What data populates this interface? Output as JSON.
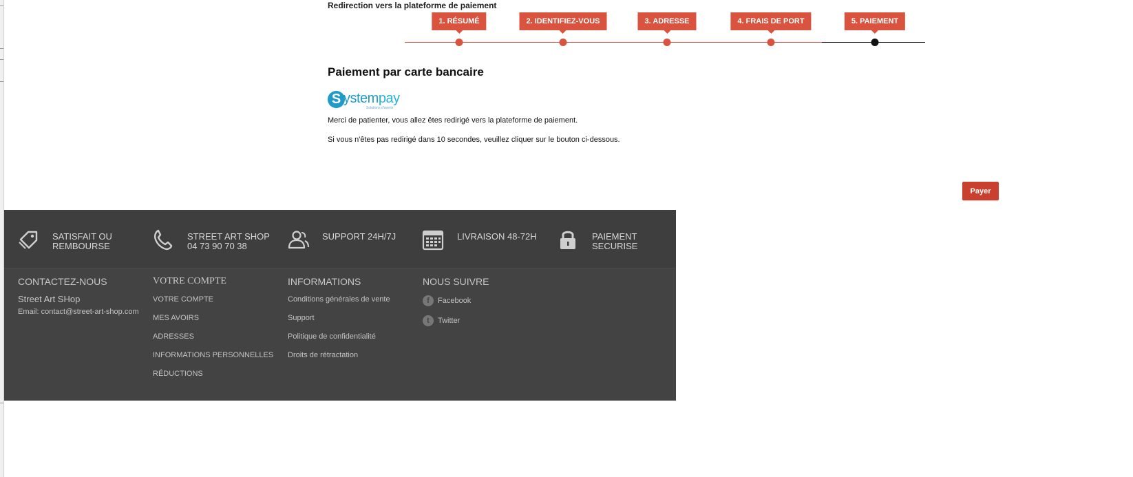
{
  "page_heading": "Redirection vers la plateforme de paiement",
  "steps": [
    {
      "label": "1. RÉSUMÉ",
      "state": "done"
    },
    {
      "label": "2. IDENTIFIEZ-VOUS",
      "state": "done"
    },
    {
      "label": "3. ADRESSE",
      "state": "done"
    },
    {
      "label": "4. FRAIS DE PORT",
      "state": "done"
    },
    {
      "label": "5. PAIEMENT",
      "state": "active"
    }
  ],
  "payment": {
    "title": "Paiement par carte bancaire",
    "logo": {
      "letter": "S",
      "word_start": "ystem",
      "word_end": "pay",
      "tagline": "Solutions d'avenir"
    },
    "message_wait": "Merci de patienter, vous allez êtes redirigé vers la plateforme de paiement.",
    "message_fallback": "Si vous n'êtes pas redirigé dans 10 secondes, veuillez cliquer sur le bouton ci-dessous.",
    "button_label": "Payer"
  },
  "footer": {
    "reassurance": [
      {
        "icon": "tag-icon",
        "text": "SATISFAIT OU REMBOURSE"
      },
      {
        "icon": "phone-icon",
        "text": "STREET ART SHOP 04 73 90 70 38"
      },
      {
        "icon": "users-icon",
        "text": "SUPPORT 24H/7J"
      },
      {
        "icon": "calendar-icon",
        "text": "LIVRAISON 48-72H"
      },
      {
        "icon": "lock-icon",
        "text": "PAIEMENT SECURISE"
      }
    ],
    "contact": {
      "heading": "CONTACTEZ-NOUS",
      "shop_name": "Street Art SHop",
      "email": "Email: contact@street-art-shop.com"
    },
    "account": {
      "heading": "VOTRE COMPTE",
      "links": [
        "VOTRE COMPTE",
        "MES AVOIRS",
        "ADRESSES",
        "INFORMATIONS PERSONNELLES",
        "RÉDUCTIONS"
      ]
    },
    "informations": {
      "heading": "INFORMATIONS",
      "links": [
        "Conditions générales de vente",
        "Support",
        "Politique de confidentialité",
        "Droits de rétractation"
      ]
    },
    "follow": {
      "heading": "NOUS SUIVRE",
      "links": [
        {
          "icon": "facebook-icon",
          "glyph": "f",
          "label": "Facebook"
        },
        {
          "icon": "twitter-icon",
          "glyph": "t",
          "label": "Twitter"
        }
      ]
    }
  },
  "colors": {
    "accent": "#d9533f",
    "button": "#c9402e",
    "footer_bg": "#434343",
    "logo_blue": "#1f9bc7"
  }
}
